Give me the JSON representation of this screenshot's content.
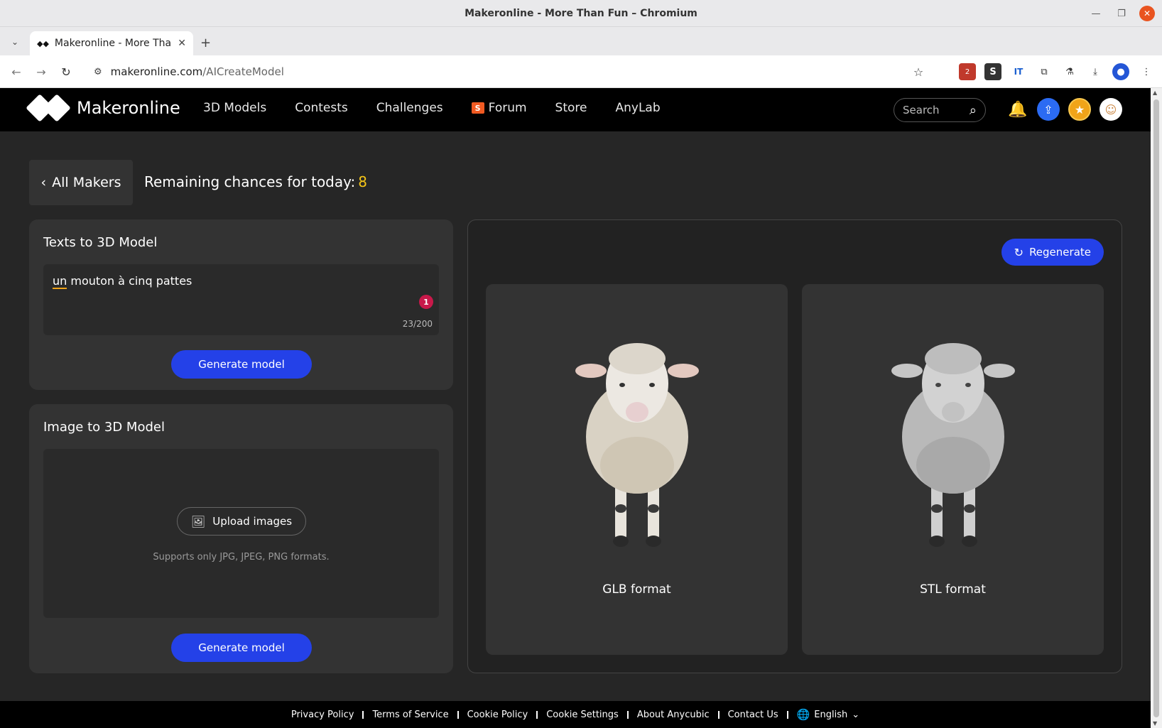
{
  "window": {
    "title": "Makeronline - More Than Fun – Chromium"
  },
  "tab": {
    "label": "Makeronline - More Than Fun",
    "favicon": "◆◆"
  },
  "address_bar": {
    "domain": "makeronline.com",
    "path": "/AICreateModel"
  },
  "extensions": {
    "badge_count": "2"
  },
  "site": {
    "brand": "Makeronline",
    "nav": [
      {
        "label": "3D Models"
      },
      {
        "label": "Contests"
      },
      {
        "label": "Challenges"
      },
      {
        "label": "Forum",
        "badge": "S"
      },
      {
        "label": "Store"
      },
      {
        "label": "AnyLab"
      }
    ],
    "search_placeholder": "Search"
  },
  "page": {
    "back_label": "All Makers",
    "remaining_label": "Remaining chances for today:",
    "remaining_count": "8"
  },
  "text_to_model": {
    "title": "Texts to 3D Model",
    "input_value_first": "un",
    "input_value_rest": " mouton à cinq pattes",
    "error_count": "1",
    "char_counter": "23/200",
    "generate_label": "Generate model"
  },
  "image_to_model": {
    "title": "Image to 3D Model",
    "upload_label": "Upload images",
    "formats_note": "Supports only JPG, JPEG, PNG formats.",
    "generate_label": "Generate model"
  },
  "results": {
    "regenerate_label": "Regenerate",
    "models": [
      {
        "format_label": "GLB format"
      },
      {
        "format_label": "STL format"
      }
    ]
  },
  "footer": {
    "links": [
      "Privacy Policy",
      "Terms of Service",
      "Cookie Policy",
      "Cookie Settings",
      "About Anycubic",
      "Contact Us"
    ],
    "language": "English"
  },
  "colors": {
    "accent_blue": "#2441e8",
    "remaining_highlight": "#f5c518",
    "forum_badge": "#f05a22",
    "error_badge": "#c8194a"
  }
}
